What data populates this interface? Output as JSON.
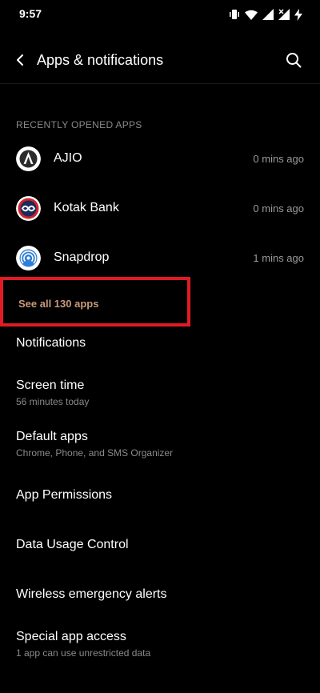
{
  "status_bar": {
    "time": "9:57",
    "icons": [
      "vibrate-icon",
      "wifi-icon",
      "signal-icon",
      "signal-icon-2",
      "charging-icon"
    ]
  },
  "app_bar": {
    "title": "Apps & notifications",
    "back_icon": "back-arrow-icon",
    "search_icon": "search-icon"
  },
  "recent": {
    "header": "RECENTLY OPENED APPS",
    "apps": [
      {
        "name": "AJIO",
        "time": "0 mins ago",
        "icon": "ajio-app-icon"
      },
      {
        "name": "Kotak Bank",
        "time": "0 mins ago",
        "icon": "kotak-app-icon"
      },
      {
        "name": "Snapdrop",
        "time": "1 mins ago",
        "icon": "snapdrop-app-icon"
      }
    ],
    "see_all": "See all 130 apps"
  },
  "menu": [
    {
      "title": "Notifications",
      "subtitle": ""
    },
    {
      "title": "Screen time",
      "subtitle": "56 minutes today"
    },
    {
      "title": "Default apps",
      "subtitle": "Chrome, Phone, and SMS Organizer"
    },
    {
      "title": "App Permissions",
      "subtitle": ""
    },
    {
      "title": "Data Usage Control",
      "subtitle": ""
    },
    {
      "title": "Wireless emergency alerts",
      "subtitle": ""
    },
    {
      "title": "Special app access",
      "subtitle": "1 app can use unrestricted data"
    }
  ],
  "colors": {
    "background": "#000000",
    "accent_text": "#c99a7a",
    "highlight_box": "#e01b24",
    "secondary_text": "#8a8a8a"
  }
}
